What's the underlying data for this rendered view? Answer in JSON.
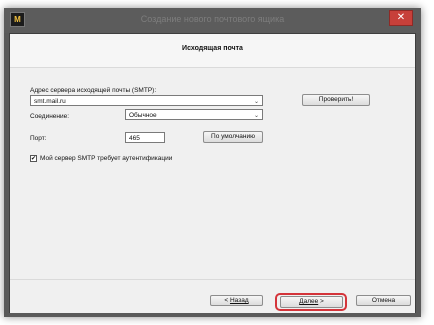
{
  "window": {
    "title": "Создание нового почтового ящика",
    "close_glyph": "✕",
    "app_icon_glyph": "M"
  },
  "page": {
    "title": "Исходящая почта"
  },
  "form": {
    "server_label": "Адрес сервера исходящей почты (SMTP):",
    "server_value": "smt.mail.ru",
    "check_button": "Проверить!",
    "connection_label": "Соединение:",
    "connection_value": "Обычное",
    "port_label": "Порт:",
    "port_value": "465",
    "default_button": "По умолчанию",
    "auth_checkbox_label": "Мой сервер SMTP требует аутентификации",
    "auth_checked": true,
    "check_glyph": "✔",
    "dropdown_glyph": "⌄"
  },
  "footer": {
    "back_prefix": "< ",
    "back_label": "Назад",
    "next_label": "Далее",
    "next_suffix": " >",
    "cancel_label": "Отмена"
  },
  "colors": {
    "highlight": "#d4343a",
    "titlebar": "#5c5c5c",
    "close": "#c7403a"
  }
}
